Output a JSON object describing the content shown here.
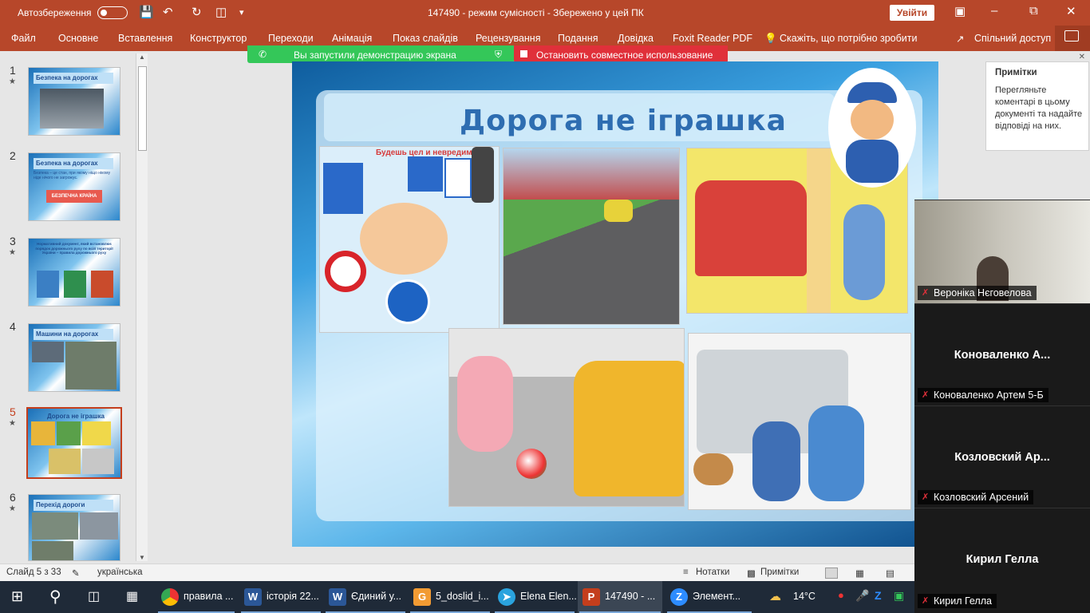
{
  "titlebar": {
    "autosave_label": "Автозбереження",
    "doc_title": "147490  -  режим сумісності  -  Збережено у цей ПК",
    "signin_label": "Увійти",
    "colors": {
      "accent": "#b7472a"
    }
  },
  "ribbon": {
    "tabs": [
      "Файл",
      "Основне",
      "Вставлення",
      "Конструктор",
      "Переходи",
      "Анімація",
      "Показ слайдів",
      "Рецензування",
      "Подання",
      "Довідка",
      "Foxit Reader PDF"
    ],
    "tell_me": "Скажіть, що потрібно зробити",
    "share": "Спільний доступ"
  },
  "banner": {
    "sharing_text": "Вы запустили демонстрацию экрана",
    "stop_text": "Остановить совместное использование"
  },
  "thumbnails": [
    {
      "num": "1",
      "title": "Безпека на дорогах",
      "starred": true
    },
    {
      "num": "2",
      "title": "Безпека на дорогах",
      "starred": false,
      "text": "Безпека – це стан, при якому ніщо нікому ніде нічого не загрожує.",
      "badge": "БЕЗПЕЧНА КРАЇНА"
    },
    {
      "num": "3",
      "title": "Нормативний документ, який встановлює порядок дорожнього руху по всій території України – правила дорожнього руху",
      "starred": true
    },
    {
      "num": "4",
      "title": "Машини на дорогах",
      "starred": false
    },
    {
      "num": "5",
      "title": "Дорога не іграшка",
      "starred": true,
      "active": true
    },
    {
      "num": "6",
      "title": "Перехід дороги",
      "starred": true
    }
  ],
  "slide": {
    "title": "Дорога не іграшка",
    "banner_text": "Будешь цел и невредим!"
  },
  "notes_pane": {
    "header": "Примітки",
    "body": "Перегляньте коментарі в цьому документі та надайте відповіді на них."
  },
  "participants": [
    {
      "name": "Вероніка Нєговелова",
      "big": "",
      "video": true
    },
    {
      "name": "Коноваленко Артем 5-Б",
      "big": "Коноваленко  А..."
    },
    {
      "name": "Козловский Арсений",
      "big": "Козловский  Ар..."
    },
    {
      "name": "Кирил Гелла",
      "big": "Кирил Гелла"
    }
  ],
  "statusbar": {
    "slide_info": "Слайд 5 з 33",
    "language": "українська",
    "notes_btn": "Нотатки",
    "comments_btn": "Примітки"
  },
  "taskbar": {
    "apps": [
      {
        "label": "правила ...",
        "icon": "chrome-icon"
      },
      {
        "label": "історія 22...",
        "icon": "word-icon"
      },
      {
        "label": "Єдиний у...",
        "icon": "word-icon"
      },
      {
        "label": "5_doslid_i...",
        "icon": "pdf-icon"
      },
      {
        "label": "Elena Elen...",
        "icon": "telegram-icon"
      },
      {
        "label": "147490  - ...",
        "icon": "powerpoint-icon"
      },
      {
        "label": "Элемент...",
        "icon": "zoom-icon"
      }
    ],
    "weather": "14°C"
  }
}
